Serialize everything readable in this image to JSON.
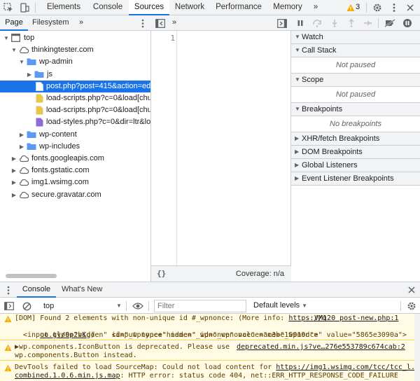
{
  "colors": {
    "accent": "#1a73e8",
    "warning": "#f9ab00",
    "folder": "#5a9af2",
    "file_script": "#e8c74c",
    "file_style": "#8e6ad6",
    "warning_bg": "#fffbe5"
  },
  "toolbar": {
    "tabs": [
      "Elements",
      "Console",
      "Sources",
      "Network",
      "Performance",
      "Memory"
    ],
    "active_tab": "Sources",
    "more": "»",
    "warning_count": "3"
  },
  "navigator": {
    "tabs": [
      "Page",
      "Filesystem"
    ],
    "more": "»",
    "tree": [
      {
        "label": "top",
        "depth": 0,
        "icon": "frame-icon",
        "expanded": true
      },
      {
        "label": "thinkingtester.com",
        "depth": 1,
        "icon": "cloud-icon",
        "expanded": true
      },
      {
        "label": "wp-admin",
        "depth": 2,
        "icon": "folder-icon",
        "expanded": true
      },
      {
        "label": "js",
        "depth": 3,
        "icon": "folder-icon",
        "expanded": false
      },
      {
        "label": "post.php?post=415&action=edit",
        "depth": 3,
        "icon": "file-doc-icon",
        "selected": true
      },
      {
        "label": "load-scripts.php?c=0&load[chun",
        "depth": 3,
        "icon": "file-script-icon"
      },
      {
        "label": "load-scripts.php?c=0&load[chun",
        "depth": 3,
        "icon": "file-script-icon"
      },
      {
        "label": "load-styles.php?c=0&dir=ltr&loac",
        "depth": 3,
        "icon": "file-style-icon"
      },
      {
        "label": "wp-content",
        "depth": 2,
        "icon": "folder-icon",
        "expanded": false
      },
      {
        "label": "wp-includes",
        "depth": 2,
        "icon": "folder-icon",
        "expanded": false
      },
      {
        "label": "fonts.googleapis.com",
        "depth": 1,
        "icon": "cloud-icon",
        "expanded": false
      },
      {
        "label": "fonts.gstatic.com",
        "depth": 1,
        "icon": "cloud-icon",
        "expanded": false
      },
      {
        "label": "img1.wsimg.com",
        "depth": 1,
        "icon": "cloud-icon",
        "expanded": false
      },
      {
        "label": "secure.gravatar.com",
        "depth": 1,
        "icon": "cloud-icon",
        "expanded": false
      }
    ]
  },
  "editor": {
    "more": "»",
    "line_number": "1",
    "pretty_print": "{}",
    "coverage": "Coverage: n/a"
  },
  "debugger": {
    "sections": [
      {
        "title": "Watch",
        "body": null
      },
      {
        "title": "Call Stack",
        "body": "Not paused"
      },
      {
        "title": "Scope",
        "body": "Not paused"
      },
      {
        "title": "Breakpoints",
        "body": "No breakpoints"
      },
      {
        "title": "XHR/fetch Breakpoints",
        "body": null,
        "collapsed": true
      },
      {
        "title": "DOM Breakpoints",
        "body": null,
        "collapsed": true
      },
      {
        "title": "Global Listeners",
        "body": null,
        "collapsed": true
      },
      {
        "title": "Event Listener Breakpoints",
        "body": null,
        "collapsed": true
      }
    ]
  },
  "drawer": {
    "tabs": [
      "Console",
      "What's New"
    ],
    "context": "top",
    "filter_placeholder": "Filter",
    "levels": "Default levels",
    "messages": [
      {
        "line1_pre": "[DOM] Found 2 elements with non-unique id #_wpnonce: (More info: ",
        "line1_link": "https://g",
        "line1_source": "VM120 post-new.php:1",
        "line2_link": "oo.gl/9p2vKg",
        "line2_rest": ")    <input type=\"hidden\" id=\"_wpnonce\" name=\"_wpnonce\" value=\"5865e3090a\">",
        "line3": "<input type=\"hidden\" id=\"_wpnonce\" name=\"_wpnonce\" value=\"c3be15919d\">"
      },
      {
        "line1_pre": "▶wp.components.IconButton is deprecated. Please use",
        "line1_source": "deprecated.min.js?ve…276e553789c674cab:2",
        "line2": "wp.components.Button instead."
      },
      {
        "line1_pre": "DevTools failed to load SourceMap: Could not load content for ",
        "line1_link": "https://img1.wsimg.com/tcc/tcc_l.",
        "line2_link": "combined.1.0.6.min.js.map",
        "line2_rest": ": HTTP error: status code 404, net::ERR_HTTP_RESPONSE_CODE_FAILURE"
      }
    ]
  }
}
